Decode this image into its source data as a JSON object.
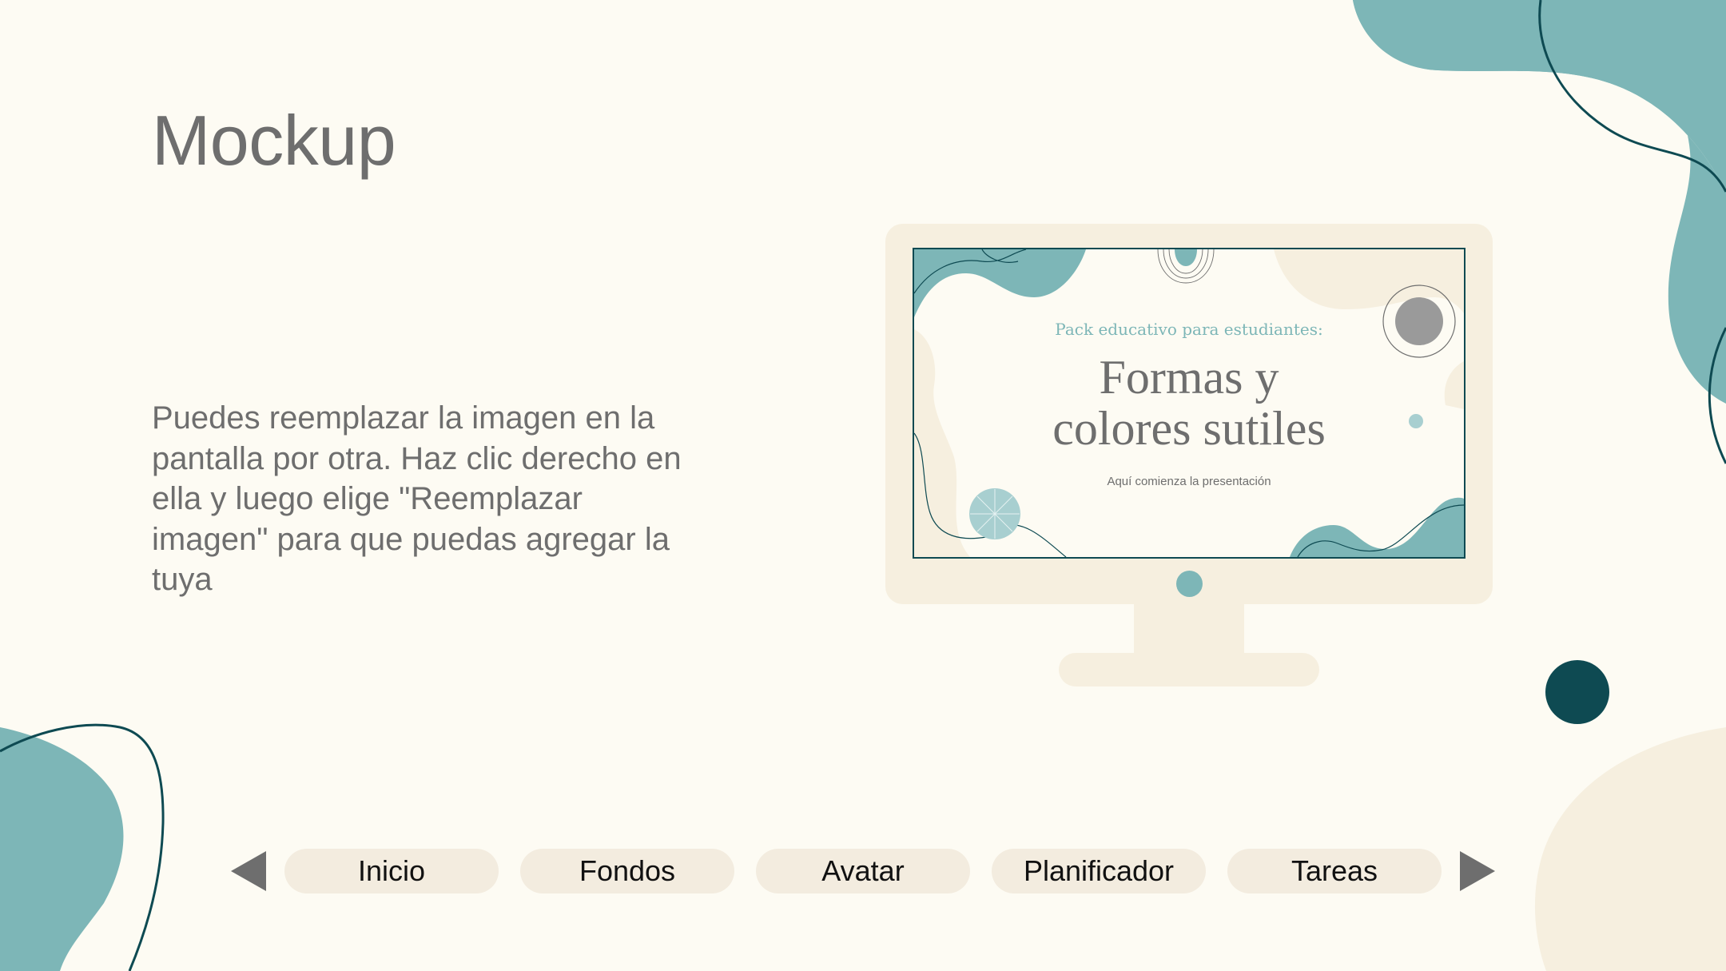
{
  "slide": {
    "title": "Mockup",
    "body": "Puedes reemplazar la imagen en la pantalla por otra. Haz clic derecho en ella y luego elige \"Reemplazar imagen\" para que puedas agregar la tuya"
  },
  "monitor_screen": {
    "subtitle": "Pack educativo para estudiantes:",
    "title_line1": "Formas y",
    "title_line2": "colores sutiles",
    "caption": "Aquí comienza la presentación"
  },
  "nav": {
    "prev_icon": "triangle-left-icon",
    "next_icon": "triangle-right-icon",
    "buttons": [
      {
        "label": "Inicio"
      },
      {
        "label": "Fondos"
      },
      {
        "label": "Avatar"
      },
      {
        "label": "Planificador"
      },
      {
        "label": "Tareas"
      }
    ]
  },
  "colors": {
    "background": "#FDFBF3",
    "teal": "#7DB6B7",
    "dark_teal": "#0E4A52",
    "cream": "#F6EFDF",
    "text_gray": "#6E6E6E",
    "button_bg": "#F3ECDF"
  }
}
